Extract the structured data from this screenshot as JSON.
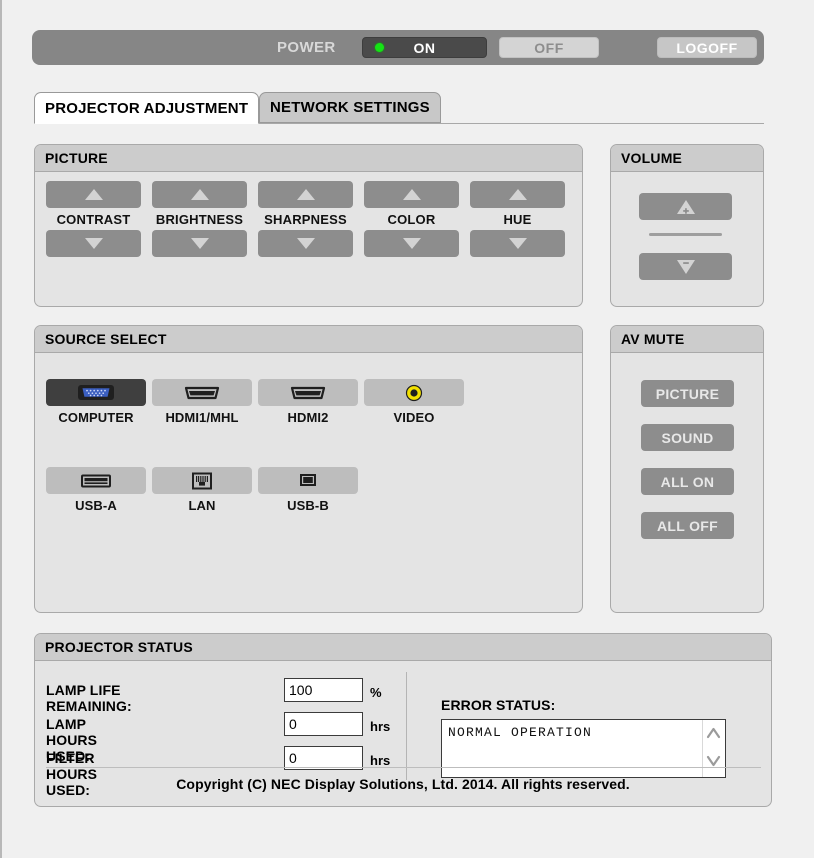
{
  "power_bar": {
    "label": "POWER",
    "on_label": "ON",
    "off_label": "OFF",
    "logoff_label": "LOGOFF",
    "state": "ON",
    "led_color": "#15e215"
  },
  "tabs": [
    {
      "label": "PROJECTOR ADJUSTMENT",
      "active": true
    },
    {
      "label": "NETWORK SETTINGS",
      "active": false
    }
  ],
  "picture": {
    "title": "PICTURE",
    "controls": [
      {
        "label": "CONTRAST",
        "up_icon": "triangle-up-icon",
        "down_icon": "triangle-down-icon"
      },
      {
        "label": "BRIGHTNESS",
        "up_icon": "triangle-up-icon",
        "down_icon": "triangle-down-icon"
      },
      {
        "label": "SHARPNESS",
        "up_icon": "triangle-up-icon",
        "down_icon": "triangle-down-icon"
      },
      {
        "label": "COLOR",
        "up_icon": "triangle-up-icon",
        "down_icon": "triangle-down-icon"
      },
      {
        "label": "HUE",
        "up_icon": "triangle-up-icon",
        "down_icon": "triangle-down-icon"
      }
    ]
  },
  "volume": {
    "title": "VOLUME",
    "up_icon": "volume-up-icon",
    "down_icon": "volume-down-icon"
  },
  "source_select": {
    "title": "SOURCE SELECT",
    "selected": "COMPUTER",
    "sources": [
      {
        "label": "COMPUTER",
        "icon": "vga-connector-icon",
        "selected": true
      },
      {
        "label": "HDMI1/MHL",
        "icon": "hdmi-port-icon",
        "selected": false
      },
      {
        "label": "HDMI2",
        "icon": "hdmi-port-icon",
        "selected": false
      },
      {
        "label": "VIDEO",
        "icon": "rca-composite-icon",
        "selected": false
      },
      {
        "label": "USB-A",
        "icon": "usb-a-port-icon",
        "selected": false
      },
      {
        "label": "LAN",
        "icon": "rj45-lan-port-icon",
        "selected": false
      },
      {
        "label": "USB-B",
        "icon": "usb-b-port-icon",
        "selected": false
      }
    ]
  },
  "av_mute": {
    "title": "AV MUTE",
    "buttons": [
      {
        "label": "PICTURE"
      },
      {
        "label": "SOUND"
      },
      {
        "label": "ALL ON"
      },
      {
        "label": "ALL OFF"
      }
    ]
  },
  "projector_status": {
    "title": "PROJECTOR STATUS",
    "rows": [
      {
        "label": "LAMP LIFE REMAINING:",
        "value": "100",
        "unit": "%"
      },
      {
        "label": "LAMP HOURS USED:",
        "value": "0",
        "unit": "hrs"
      },
      {
        "label": "FILTER HOURS USED:",
        "value": "0",
        "unit": "hrs"
      }
    ],
    "error_status": {
      "title": "ERROR STATUS:",
      "text": "NORMAL OPERATION"
    },
    "copyright": "Copyright (C) NEC Display Solutions, Ltd. 2014. All rights reserved."
  }
}
